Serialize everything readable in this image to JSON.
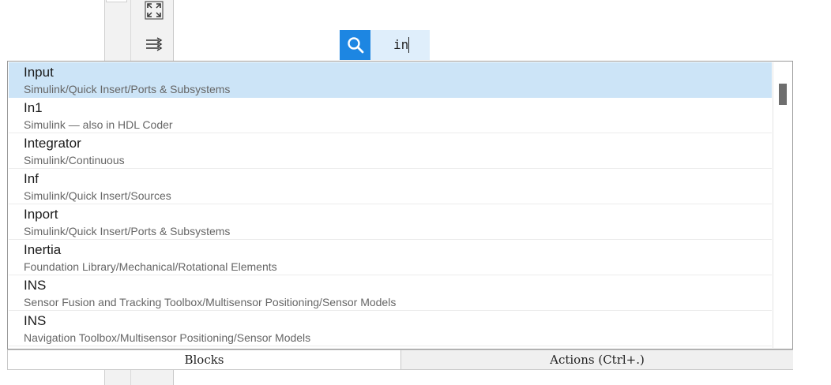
{
  "toolbar": {
    "icons": [
      "fit-to-view-icon",
      "route-lines-icon"
    ]
  },
  "search": {
    "value": "in",
    "icon": "search-icon",
    "button_color": "#1d86e2"
  },
  "results": [
    {
      "name": "Input",
      "path": "Simulink/Quick Insert/Ports & Subsystems",
      "selected": true
    },
    {
      "name": "In1",
      "path": "Simulink — also in HDL Coder"
    },
    {
      "name": "Integrator",
      "path": "Simulink/Continuous"
    },
    {
      "name": "Inf",
      "path": "Simulink/Quick Insert/Sources"
    },
    {
      "name": "Inport",
      "path": "Simulink/Quick Insert/Ports & Subsystems"
    },
    {
      "name": "Inertia",
      "path": "Foundation Library/Mechanical/Rotational Elements"
    },
    {
      "name": "INS",
      "path": "Sensor Fusion and Tracking Toolbox/Multisensor Positioning/Sensor Models"
    },
    {
      "name": "INS",
      "path": "Navigation Toolbox/Multisensor Positioning/Sensor Models"
    }
  ],
  "tabs": {
    "blocks": "Blocks",
    "actions": "Actions (Ctrl+.)"
  },
  "colors": {
    "selection": "#cce4f7",
    "search_field": "#dfeefb"
  }
}
